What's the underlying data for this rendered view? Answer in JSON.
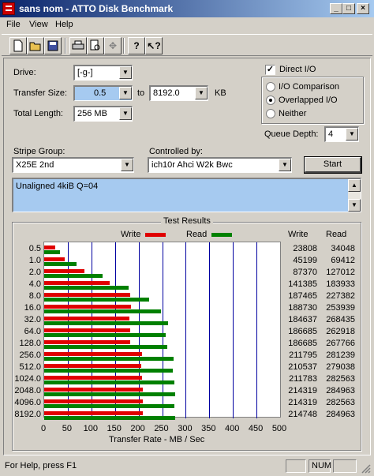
{
  "window": {
    "title": "sans nom - ATTO Disk Benchmark",
    "buttons": {
      "minimize": "_",
      "maximize": "□",
      "close": "×"
    }
  },
  "menu": [
    "File",
    "View",
    "Help"
  ],
  "toolbar": [
    "new-icon",
    "open-icon",
    "save-icon",
    "print-icon",
    "print-preview-icon",
    "move-icon",
    "help-icon",
    "context-help-icon"
  ],
  "form": {
    "drive_label": "Drive:",
    "drive_value": "[-g-]",
    "transfer_label": "Transfer Size:",
    "transfer_from": "0.5",
    "to_label": "to",
    "transfer_to": "8192.0",
    "kb_label": "KB",
    "length_label": "Total Length:",
    "length_value": "256 MB",
    "direct_io_label": "Direct I/O",
    "direct_io_checked": true,
    "radio_io_comparison": "I/O Comparison",
    "radio_overlapped": "Overlapped I/O",
    "radio_neither": "Neither",
    "queue_label": "Queue Depth:",
    "queue_value": "4",
    "stripe_label": "Stripe Group:",
    "stripe_value": "X25E 2nd",
    "controlled_label": "Controlled by:",
    "controlled_value": "ich10r Ahci W2k Bwc",
    "start_label": "Start",
    "description": "Unaligned 4kiB Q=04"
  },
  "results": {
    "title": "Test Results",
    "legend_write": "Write",
    "legend_read": "Read",
    "col_write": "Write",
    "col_read": "Read",
    "xlabel": "Transfer Rate - MB / Sec",
    "xticks": [
      "0",
      "50",
      "100",
      "150",
      "200",
      "250",
      "300",
      "350",
      "400",
      "450",
      "500"
    ]
  },
  "chart_data": {
    "type": "bar",
    "orientation": "horizontal",
    "title": "Test Results",
    "xlabel": "Transfer Rate - MB / Sec",
    "xlim": [
      0,
      500
    ],
    "categories": [
      "0.5",
      "1.0",
      "2.0",
      "4.0",
      "8.0",
      "16.0",
      "32.0",
      "64.0",
      "128.0",
      "256.0",
      "512.0",
      "1024.0",
      "2048.0",
      "4096.0",
      "8192.0"
    ],
    "series": [
      {
        "name": "Write",
        "color": "#e00000",
        "values": [
          23808,
          45199,
          87370,
          141385,
          187465,
          188730,
          184637,
          186685,
          186685,
          211795,
          210537,
          211783,
          214319,
          214319,
          214748
        ]
      },
      {
        "name": "Read",
        "color": "#008000",
        "values": [
          34048,
          69412,
          127012,
          183933,
          227382,
          253939,
          268435,
          262918,
          267766,
          281239,
          279038,
          282563,
          284963,
          282563,
          284963
        ]
      }
    ],
    "value_units_note": "KB/s"
  },
  "statusbar": {
    "text": "For Help, press F1",
    "num": "NUM"
  }
}
